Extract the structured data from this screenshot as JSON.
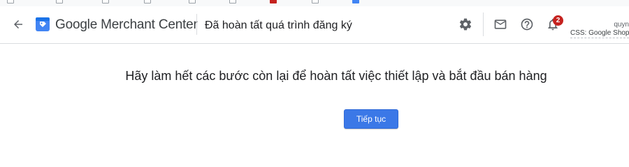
{
  "header": {
    "app_title": "Google Merchant Center",
    "page_title": "Đã hoàn tất quá trình đăng ký",
    "notification_count": "2",
    "account_name": "quyn",
    "account_sub": "CSS: Google Shopping"
  },
  "icons": {
    "back": "arrow-back-icon",
    "logo": "merchant-center-logo",
    "settings": "gear-icon",
    "mail": "mail-icon",
    "help": "help-icon",
    "notifications": "bell-icon"
  },
  "main": {
    "message": "Hãy làm hết các bước còn lại để hoàn tất việc thiết lập và bắt đầu bán hàng",
    "continue_label": "Tiếp tục"
  },
  "colors": {
    "primary_button": "#3b78e7",
    "badge": "#c5221f",
    "logo_blue": "#4285f4",
    "border": "#dadce0"
  }
}
